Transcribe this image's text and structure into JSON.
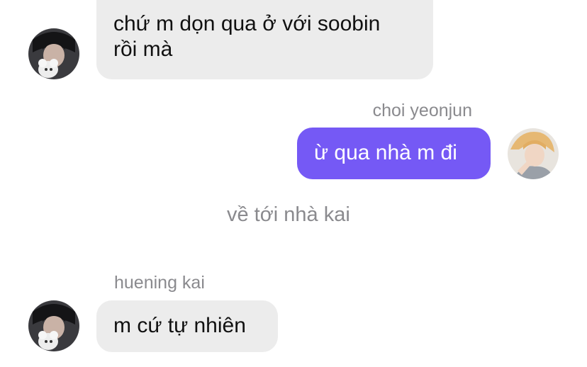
{
  "colors": {
    "incoming_bubble": "#ececec",
    "outgoing_bubble": "#7559f5",
    "meta_text": "#8a8a8e"
  },
  "messages": [
    {
      "direction": "incoming",
      "line1": "chứ m dọn qua ở với soobin",
      "line2": "rồi mà"
    },
    {
      "direction": "outgoing",
      "sender": "choi yeonjun",
      "text": "ừ qua nhà m đi"
    },
    {
      "direction": "system",
      "text": "về tới nhà kai"
    },
    {
      "direction": "incoming",
      "sender": "huening kai",
      "text": "m cứ tự nhiên"
    }
  ]
}
